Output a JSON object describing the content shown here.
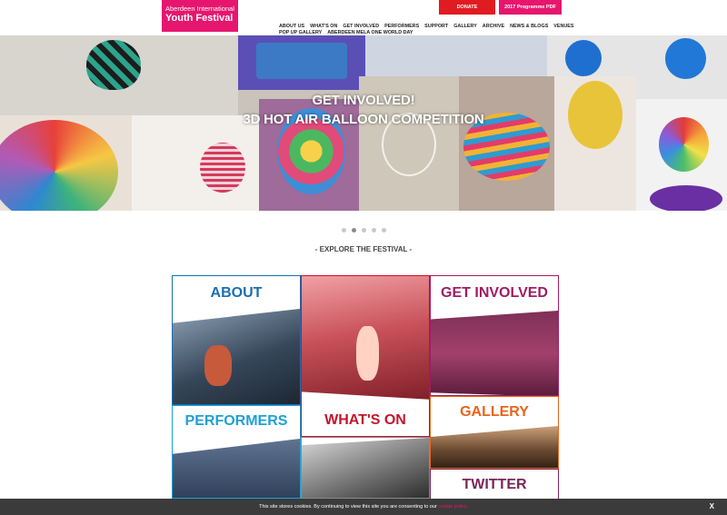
{
  "header": {
    "logo_line1": "Aberdeen International",
    "logo_line2": "Youth Festival",
    "donate_label": "DONATE",
    "pdf_label": "2017 Programme PDF",
    "nav_row1": [
      "ABOUT US",
      "WHAT'S ON",
      "GET INVOLVED",
      "PERFORMERS",
      "SUPPORT",
      "GALLERY",
      "ARCHIVE",
      "NEWS & BLOGS",
      "VENUES"
    ],
    "nav_row2": [
      "POP UP GALLERY",
      "ABERDEEN MELA ONE WORLD DAY"
    ]
  },
  "hero": {
    "line1": "GET INVOLVED!",
    "line2": "3D HOT AIR BALLOON COMPETITION"
  },
  "carousel": {
    "slide_count": 5,
    "active_index": 1
  },
  "explore_heading": "- EXPLORE THE FESTIVAL -",
  "tiles": {
    "about": "ABOUT",
    "performers": "PERFORMERS",
    "whats_on": "WHAT'S ON",
    "get_involved": "GET INVOLVED",
    "gallery": "GALLERY",
    "twitter": "TWITTER"
  },
  "colors": {
    "brand_pink": "#e6166e",
    "donate_red": "#e11b22",
    "about_blue": "#1b6fb0",
    "performers_cyan": "#1ea0d5",
    "whats_on_red": "#c4142b",
    "get_involved_magenta": "#a01c62",
    "gallery_orange": "#e8641b",
    "twitter_plum": "#7a2657"
  },
  "cookie": {
    "message": "This site stores cookies. By continuing to view this site you are consenting to our",
    "link": "cookie policy.",
    "close": "X"
  }
}
